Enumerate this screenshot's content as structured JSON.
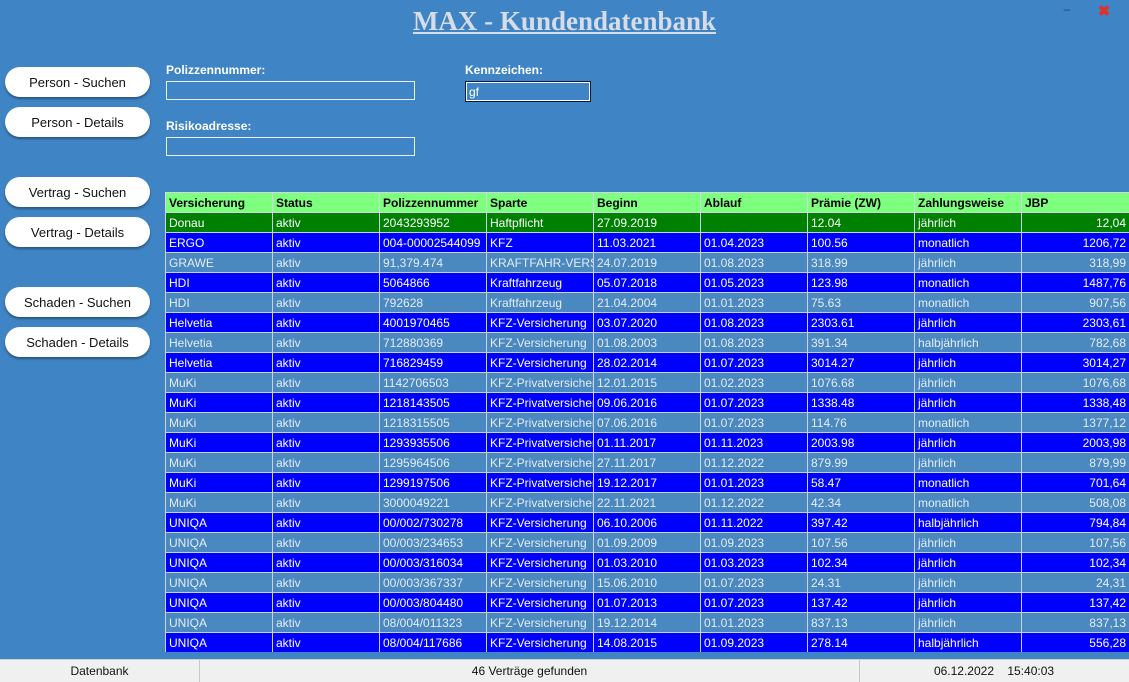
{
  "app": {
    "title": "MAX - Kundendatenbank"
  },
  "window": {
    "min_glyph": "–",
    "close_glyph": "✖"
  },
  "nav": {
    "person_search": "Person - Suchen",
    "person_details": "Person - Details",
    "contract_search": "Vertrag - Suchen",
    "contract_details": "Vertrag - Details",
    "claim_search": "Schaden - Suchen",
    "claim_details": "Schaden - Details"
  },
  "search": {
    "policy_label": "Polizzennummer:",
    "policy_value": "",
    "plate_label": "Kennzeichen:",
    "plate_value": "gf",
    "risk_label": "Risikoadresse:",
    "risk_value": ""
  },
  "table": {
    "columns": [
      "Versicherung",
      "Status",
      "Polizzennummer",
      "Sparte",
      "Beginn",
      "Ablauf",
      "Prämie (ZW)",
      "Zahlungsweise",
      "JBP"
    ],
    "rows": [
      {
        "style": "green",
        "cells": [
          "Donau",
          "aktiv",
          "2043293952",
          "Haftpflicht",
          "27.09.2019",
          "",
          "12.04",
          "jährlich",
          "12,04"
        ]
      },
      {
        "style": "blue",
        "cells": [
          "ERGO",
          "aktiv",
          "004-00002544099",
          "KFZ",
          "11.03.2021",
          "01.04.2023",
          "100.56",
          "monatlich",
          "1206,72"
        ]
      },
      {
        "style": "grey",
        "cells": [
          "GRAWE",
          "aktiv",
          "91,379.474",
          "KRAFTFAHR-VERSICHERUNG",
          "24.07.2019",
          "01.08.2023",
          "318.99",
          "jährlich",
          "318,99"
        ]
      },
      {
        "style": "blue",
        "cells": [
          "HDI",
          "aktiv",
          "5064866",
          "Kraftfahrzeug",
          "05.07.2018",
          "01.05.2023",
          "123.98",
          "monatlich",
          "1487,76"
        ]
      },
      {
        "style": "grey",
        "cells": [
          "HDI",
          "aktiv",
          "792628",
          "Kraftfahrzeug",
          "21.04.2004",
          "01.01.2023",
          "75.63",
          "monatlich",
          "907,56"
        ]
      },
      {
        "style": "blue",
        "cells": [
          "Helvetia",
          "aktiv",
          "4001970465",
          "KFZ-Versicherung",
          "03.07.2020",
          "01.08.2023",
          "2303.61",
          "jährlich",
          "2303,61"
        ]
      },
      {
        "style": "grey",
        "cells": [
          "Helvetia",
          "aktiv",
          "712880369",
          "KFZ-Versicherung",
          "01.08.2003",
          "01.08.2023",
          "391.34",
          "halbjährlich",
          "782,68"
        ]
      },
      {
        "style": "blue",
        "cells": [
          "Helvetia",
          "aktiv",
          "716829459",
          "KFZ-Versicherung",
          "28.02.2014",
          "01.07.2023",
          "3014.27",
          "jährlich",
          "3014,27"
        ]
      },
      {
        "style": "grey",
        "cells": [
          "MuKi",
          "aktiv",
          "1142706503",
          "KFZ-Privatversicherung",
          "12.01.2015",
          "01.02.2023",
          "1076.68",
          "jährlich",
          "1076,68"
        ]
      },
      {
        "style": "blue",
        "cells": [
          "MuKi",
          "aktiv",
          "1218143505",
          "KFZ-Privatversicherung",
          "09.06.2016",
          "01.07.2023",
          "1338.48",
          "jährlich",
          "1338,48"
        ]
      },
      {
        "style": "grey",
        "cells": [
          "MuKi",
          "aktiv",
          "1218315505",
          "KFZ-Privatversicherung",
          "07.06.2016",
          "01.07.2023",
          "114.76",
          "monatlich",
          "1377,12"
        ]
      },
      {
        "style": "blue",
        "cells": [
          "MuKi",
          "aktiv",
          "1293935506",
          "KFZ-Privatversicherung",
          "01.11.2017",
          "01.11.2023",
          "2003.98",
          "jährlich",
          "2003,98"
        ]
      },
      {
        "style": "grey",
        "cells": [
          "MuKi",
          "aktiv",
          "1295964506",
          "KFZ-Privatversicherung",
          "27.11.2017",
          "01.12.2022",
          "879.99",
          "jährlich",
          "879,99"
        ]
      },
      {
        "style": "blue",
        "cells": [
          "MuKi",
          "aktiv",
          "1299197506",
          "KFZ-Privatversicherung",
          "19.12.2017",
          "01.01.2023",
          "58.47",
          "monatlich",
          "701,64"
        ]
      },
      {
        "style": "grey",
        "cells": [
          "MuKi",
          "aktiv",
          "3000049221",
          "KFZ-Privatversicherung",
          "22.11.2021",
          "01.12.2022",
          "42.34",
          "monatlich",
          "508,08"
        ]
      },
      {
        "style": "blue",
        "cells": [
          "UNIQA",
          "aktiv",
          "00/002/730278",
          "KFZ-Versicherung",
          "06.10.2006",
          "01.11.2022",
          "397.42",
          "halbjährlich",
          "794,84"
        ]
      },
      {
        "style": "grey",
        "cells": [
          "UNIQA",
          "aktiv",
          "00/003/234653",
          "KFZ-Versicherung",
          "01.09.2009",
          "01.09.2023",
          "107.56",
          "jährlich",
          "107,56"
        ]
      },
      {
        "style": "blue",
        "cells": [
          "UNIQA",
          "aktiv",
          "00/003/316034",
          "KFZ-Versicherung",
          "01.03.2010",
          "01.03.2023",
          "102.34",
          "jährlich",
          "102,34"
        ]
      },
      {
        "style": "grey",
        "cells": [
          "UNIQA",
          "aktiv",
          "00/003/367337",
          "KFZ-Versicherung",
          "15.06.2010",
          "01.07.2023",
          "24.31",
          "jährlich",
          "24,31"
        ]
      },
      {
        "style": "blue",
        "cells": [
          "UNIQA",
          "aktiv",
          "00/003/804480",
          "KFZ-Versicherung",
          "01.07.2013",
          "01.07.2023",
          "137.42",
          "jährlich",
          "137,42"
        ]
      },
      {
        "style": "grey",
        "cells": [
          "UNIQA",
          "aktiv",
          "08/004/011323",
          "KFZ-Versicherung",
          "19.12.2014",
          "01.01.2023",
          "837.13",
          "jährlich",
          "837,13"
        ]
      },
      {
        "style": "blue",
        "cells": [
          "UNIQA",
          "aktiv",
          "08/004/117686",
          "KFZ-Versicherung",
          "14.08.2015",
          "01.09.2023",
          "278.14",
          "halbjährlich",
          "556,28"
        ]
      }
    ]
  },
  "statusbar": {
    "left": "Datenbank",
    "center": "46 Verträge gefunden",
    "right": "06.12.2022    15:40:03"
  },
  "colors": {
    "background": "#3f84c4",
    "header": "#7fff7f",
    "row_blue": "#0000ff",
    "row_grey": "#4a88c0",
    "row_green": "#008000"
  }
}
